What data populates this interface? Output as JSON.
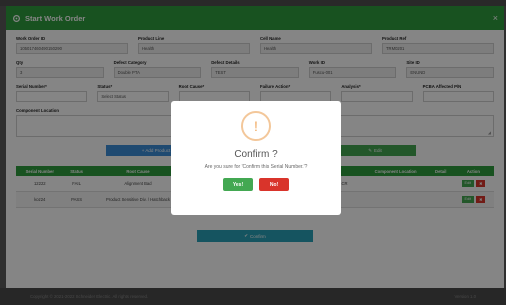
{
  "modal": {
    "title": "Start Work Order",
    "close_glyph": "×"
  },
  "form": {
    "row1": [
      {
        "label": "Work Order ID",
        "value": "105017460490150290"
      },
      {
        "label": "Product Line",
        "value": "Health"
      },
      {
        "label": "Cell Name",
        "value": "Health"
      },
      {
        "label": "Product Ref",
        "value": "TRM0201"
      }
    ],
    "row2": [
      {
        "label": "Qty",
        "value": "3"
      },
      {
        "label": "Defect Category",
        "value": "Double PTA"
      },
      {
        "label": "Defect Details",
        "value": "TEST"
      },
      {
        "label": "Work ID",
        "value": "Fuscu-001"
      },
      {
        "label": "Site ID",
        "value": "ENUND"
      }
    ],
    "row3": [
      {
        "label": "Serial Number*",
        "value": ""
      },
      {
        "label": "Status*",
        "value": "Select Status"
      },
      {
        "label": "Root Cause*",
        "value": ""
      },
      {
        "label": "Failure Action*",
        "value": ""
      },
      {
        "label": "Analysis*",
        "value": ""
      },
      {
        "label": "PCBA Affected P/N",
        "value": ""
      }
    ],
    "component_location_label": "Component Location",
    "add_button": "+ Add Product",
    "edit_button": "Edit"
  },
  "table": {
    "headers": [
      "Serial Number",
      "Status",
      "Root Cause",
      "",
      "",
      "",
      "Component Location",
      "Detail",
      "Action"
    ],
    "rows": [
      [
        "12222",
        "FAIL",
        "Alignment Bad",
        "patch go up & dur",
        "9/8",
        "P/A.PA/P0R.CAR/8.G/R/G.CR",
        "",
        "",
        ""
      ],
      [
        "koz24",
        "PASS",
        "Product Sensitive Div. / Hatchback",
        "Di electric - placement ng",
        "5/8",
        "789223",
        "",
        "",
        ""
      ]
    ],
    "edit_label": "Edit",
    "delete_label": "✖"
  },
  "confirm_button": "Confirm",
  "dialog": {
    "icon": "!",
    "title": "Confirm ?",
    "message": "Are you sure for 'Confirm this Serial Number.'?",
    "yes_label": "Yes!",
    "no_label": "No!"
  },
  "footer": {
    "copyright": "Copyright © 2021-2022 Schneider Electric. All rights reserved.",
    "version": "Version 1.0"
  },
  "colors": {
    "header_green": "#2f9e3f",
    "add_blue": "#3d8fd9",
    "confirm_teal": "#2aa2b8",
    "yes_green": "#43a852",
    "no_red": "#d9342b",
    "warning_orange": "#f0a85f"
  }
}
